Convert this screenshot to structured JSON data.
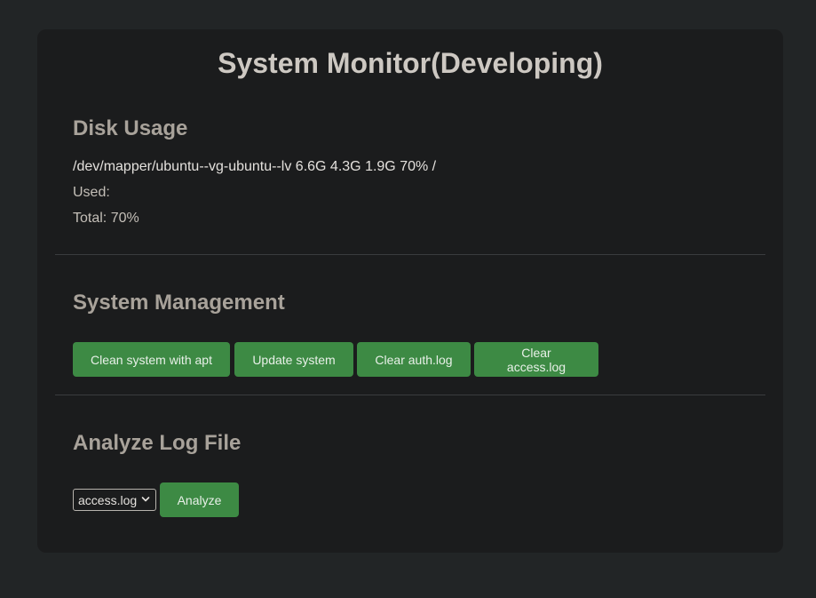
{
  "page": {
    "title": "System Monitor(Developing)"
  },
  "disk": {
    "heading": "Disk Usage",
    "line": "/dev/mapper/ubuntu--vg-ubuntu--lv 6.6G 4.3G 1.9G 70% /",
    "used": "Used:",
    "total": "Total: 70%"
  },
  "management": {
    "heading": "System Management",
    "buttons": {
      "clean": "Clean system with apt",
      "update": "Update system",
      "clear_auth": "Clear auth.log",
      "clear_access": "Clear access.log"
    }
  },
  "analyze": {
    "heading": "Analyze Log File",
    "select_value": "access.log",
    "button": "Analyze"
  },
  "colors": {
    "background": "#222526",
    "card": "#1b1c1d",
    "accent_green": "#3d8a44",
    "heading": "#a8a29a",
    "title": "#cdc8c2"
  },
  "icons": {
    "select_arrow": "chevron-down-icon"
  }
}
